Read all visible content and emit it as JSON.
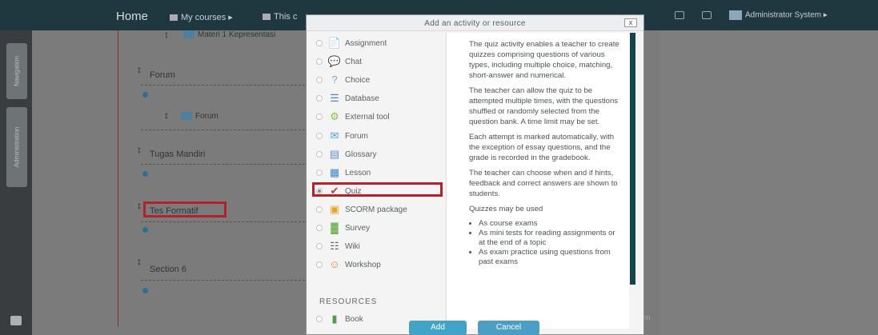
{
  "navbar": {
    "home": "Home",
    "my_courses": "My courses ▸",
    "this_course": "This c",
    "user": "Administrator System ▸"
  },
  "blocks": {
    "tab1": "Navigation",
    "tab2": "Administration"
  },
  "page": {
    "top_activity": "Materi 1 Kepresentasi",
    "sections": [
      {
        "title": "Forum"
      },
      {
        "title": "Tugas Mandiri"
      },
      {
        "title": "Tes Formatif"
      },
      {
        "title": "Section 6"
      }
    ],
    "forum_activity": "Forum",
    "ghost_text": "um"
  },
  "modal": {
    "title": "Add an activity or resource",
    "close": "x",
    "activities": [
      {
        "label": "Assignment",
        "icon": "assignment-icon",
        "color": "#7aa7d6",
        "glyph": "📄"
      },
      {
        "label": "Chat",
        "icon": "chat-icon",
        "color": "#f0a830",
        "glyph": "💬"
      },
      {
        "label": "Choice",
        "icon": "choice-icon",
        "color": "#6fa6d8",
        "glyph": "?"
      },
      {
        "label": "Database",
        "icon": "database-icon",
        "color": "#4e86c6",
        "glyph": "☰"
      },
      {
        "label": "External tool",
        "icon": "external-tool-icon",
        "color": "#8cbf4a",
        "glyph": "⚙"
      },
      {
        "label": "Forum",
        "icon": "forum-icon",
        "color": "#4e9fd6",
        "glyph": "✉"
      },
      {
        "label": "Glossary",
        "icon": "glossary-icon",
        "color": "#5b8fd0",
        "glyph": "▤"
      },
      {
        "label": "Lesson",
        "icon": "lesson-icon",
        "color": "#3f86c8",
        "glyph": "▦"
      },
      {
        "label": "Quiz",
        "icon": "quiz-icon",
        "color": "#c0392b",
        "glyph": "✔"
      },
      {
        "label": "SCORM package",
        "icon": "scorm-icon",
        "color": "#f0a020",
        "glyph": "▣"
      },
      {
        "label": "Survey",
        "icon": "survey-icon",
        "color": "#5dab3e",
        "glyph": "▓"
      },
      {
        "label": "Wiki",
        "icon": "wiki-icon",
        "color": "#666666",
        "glyph": "☷"
      },
      {
        "label": "Workshop",
        "icon": "workshop-icon",
        "color": "#d9892a",
        "glyph": "☺"
      }
    ],
    "resources_heading": "RESOURCES",
    "resources": [
      {
        "label": "Book",
        "icon": "book-icon",
        "color": "#4aa342",
        "glyph": "▮"
      }
    ],
    "selected": "Quiz",
    "description": {
      "p1": "The quiz activity enables a teacher to create quizzes comprising questions of various types, including multiple choice, matching, short-answer and numerical.",
      "p2": "The teacher can allow the quiz to be attempted multiple times, with the questions shuffled or randomly selected from the question bank. A time limit may be set.",
      "p3": "Each attempt is marked automatically, with the exception of essay questions, and the grade is recorded in the gradebook.",
      "p4": "The teacher can choose when and if hints, feedback and correct answers are shown to students.",
      "p5": "Quizzes may be used",
      "bullets": [
        "As course exams",
        "As mini tests for reading assignments or at the end of a topic",
        "As exam practice using questions from past exams"
      ]
    },
    "add_label": "Add",
    "cancel_label": "Cancel"
  }
}
